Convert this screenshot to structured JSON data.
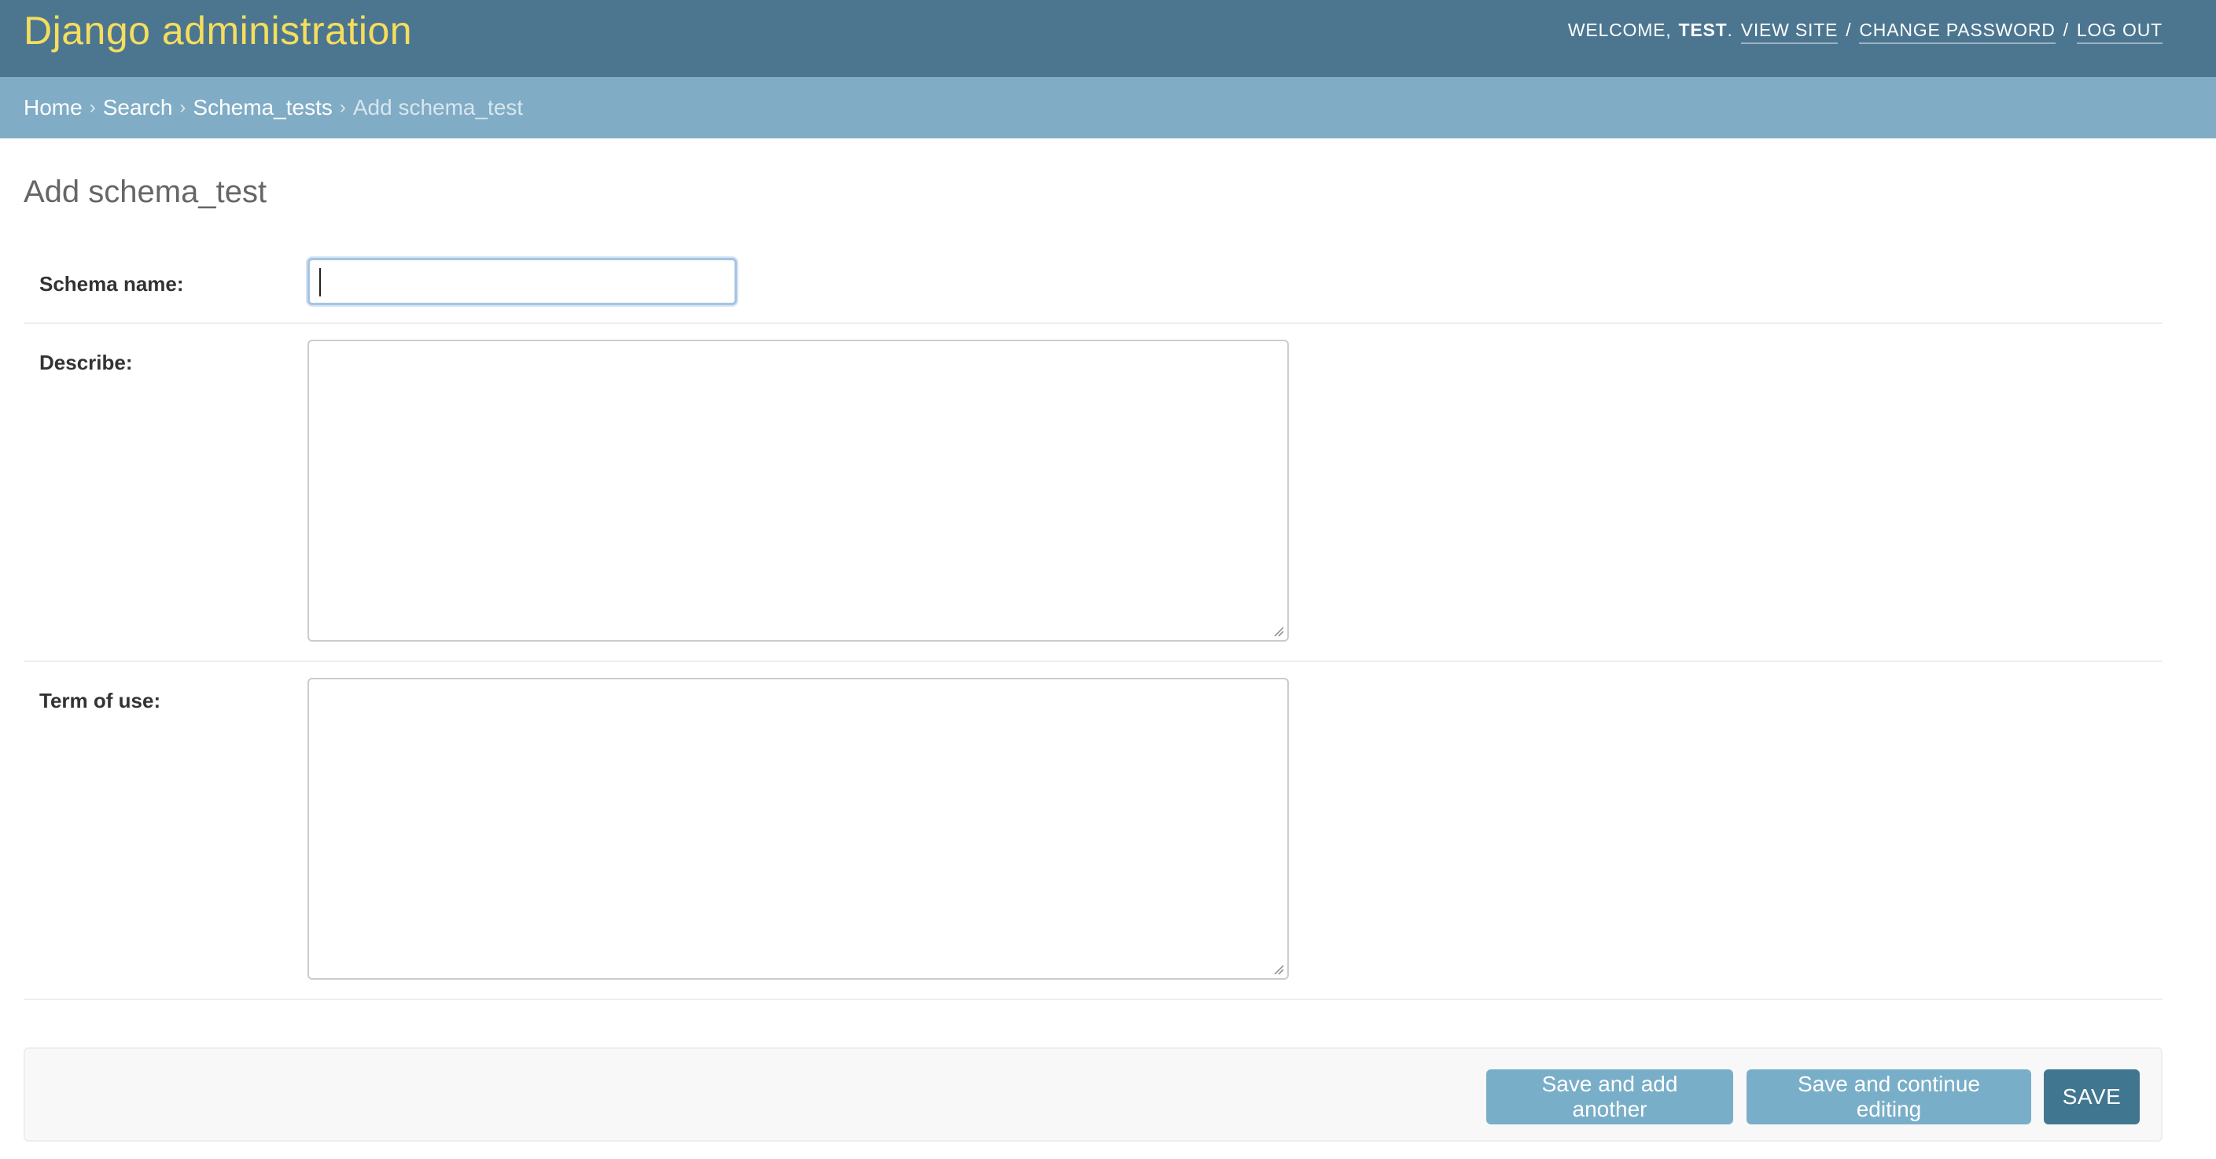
{
  "header": {
    "branding": "Django administration",
    "welcome_prefix": "Welcome,",
    "user_name": "test",
    "user_suffix": ".",
    "view_site": "View site",
    "change_password": "Change password",
    "log_out": "Log out",
    "separator": "/"
  },
  "breadcrumbs": {
    "items": [
      "Home",
      "Search",
      "Schema_tests"
    ],
    "current": "Add schema_test",
    "separator": "›"
  },
  "page": {
    "title": "Add schema_test"
  },
  "form": {
    "schema_name": {
      "label": "Schema name:",
      "value": ""
    },
    "describe": {
      "label": "Describe:",
      "value": ""
    },
    "term_of_use": {
      "label": "Term of use:",
      "value": ""
    }
  },
  "submit": {
    "save_add_another": "Save and add another",
    "save_continue": "Save and continue editing",
    "save": "Save"
  },
  "colors": {
    "header_bg": "#4c7690",
    "branding": "#f5dd5d",
    "breadcrumbs_bg": "#80acc6",
    "button_secondary": "#79aec8",
    "button_primary": "#417690"
  }
}
